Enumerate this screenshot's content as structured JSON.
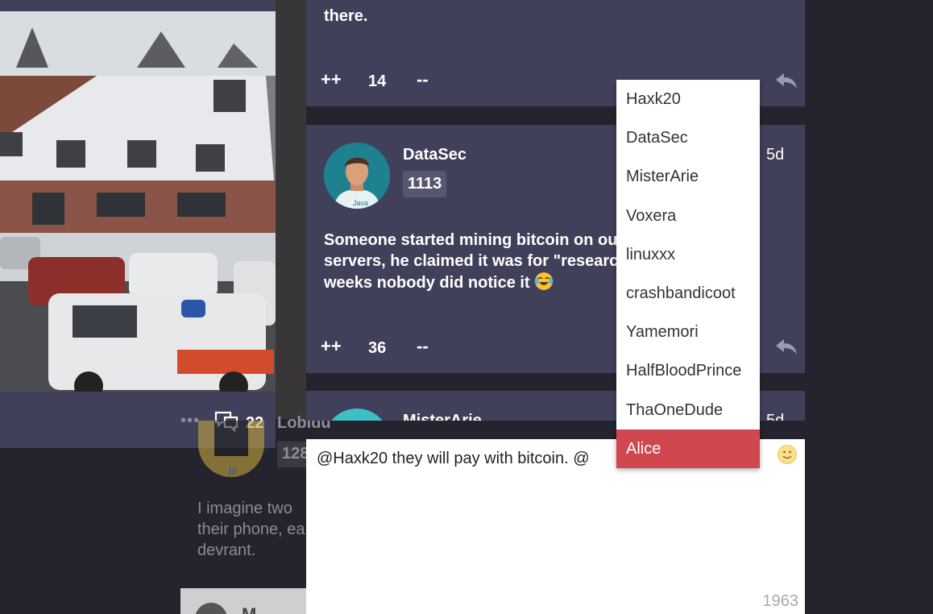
{
  "background_rant": {
    "comment_count": "22",
    "more_label": "•••"
  },
  "faded_comment": {
    "username": "Lobidu",
    "score": "128",
    "text": "I imagine two their phone, ea devrant.",
    "next_user_initial": "M"
  },
  "comments": [
    {
      "text_line": "there.",
      "votes": "14",
      "upvote": "++",
      "downvote": "--"
    },
    {
      "username": "DataSec",
      "score": "1113",
      "time": "5d",
      "text": "Someone started mining bitcoin on ou servers, he claimed it was for \"researc weeks nobody did notice it",
      "votes": "36",
      "upvote": "++",
      "downvote": "--"
    },
    {
      "username": "MisterArie",
      "time": "5d"
    }
  ],
  "composer": {
    "value": "@Haxk20 they will pay with bitcoin. @",
    "char_count": "1963"
  },
  "mention_dropdown": {
    "items": [
      "Haxk20",
      "DataSec",
      "MisterArie",
      "Voxera",
      "linuxxx",
      "crashbandicoot",
      "Yamemori",
      "HalfBloodPrince",
      "ThaOneDude",
      "Alice"
    ],
    "active_index": 9
  },
  "colors": {
    "card_bg": "#40405a",
    "page_bg": "#24232e",
    "accent_red": "#d1474f",
    "score_badge": "#575670"
  }
}
